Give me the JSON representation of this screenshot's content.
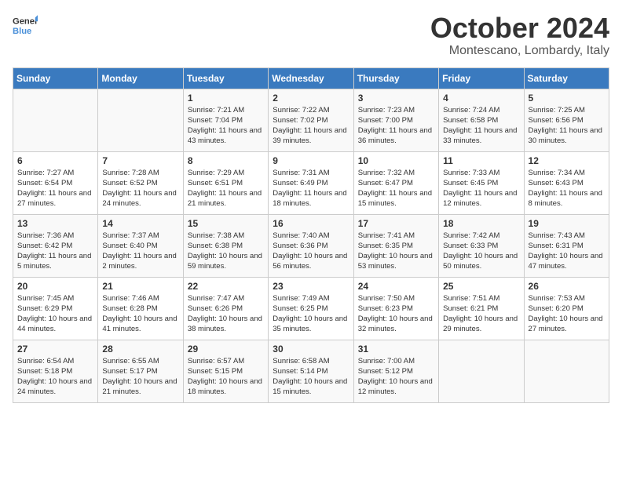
{
  "header": {
    "logo_line1": "General",
    "logo_line2": "Blue",
    "month_title": "October 2024",
    "subtitle": "Montescano, Lombardy, Italy"
  },
  "weekdays": [
    "Sunday",
    "Monday",
    "Tuesday",
    "Wednesday",
    "Thursday",
    "Friday",
    "Saturday"
  ],
  "weeks": [
    [
      {
        "day": "",
        "text": ""
      },
      {
        "day": "",
        "text": ""
      },
      {
        "day": "1",
        "text": "Sunrise: 7:21 AM\nSunset: 7:04 PM\nDaylight: 11 hours and 43 minutes."
      },
      {
        "day": "2",
        "text": "Sunrise: 7:22 AM\nSunset: 7:02 PM\nDaylight: 11 hours and 39 minutes."
      },
      {
        "day": "3",
        "text": "Sunrise: 7:23 AM\nSunset: 7:00 PM\nDaylight: 11 hours and 36 minutes."
      },
      {
        "day": "4",
        "text": "Sunrise: 7:24 AM\nSunset: 6:58 PM\nDaylight: 11 hours and 33 minutes."
      },
      {
        "day": "5",
        "text": "Sunrise: 7:25 AM\nSunset: 6:56 PM\nDaylight: 11 hours and 30 minutes."
      }
    ],
    [
      {
        "day": "6",
        "text": "Sunrise: 7:27 AM\nSunset: 6:54 PM\nDaylight: 11 hours and 27 minutes."
      },
      {
        "day": "7",
        "text": "Sunrise: 7:28 AM\nSunset: 6:52 PM\nDaylight: 11 hours and 24 minutes."
      },
      {
        "day": "8",
        "text": "Sunrise: 7:29 AM\nSunset: 6:51 PM\nDaylight: 11 hours and 21 minutes."
      },
      {
        "day": "9",
        "text": "Sunrise: 7:31 AM\nSunset: 6:49 PM\nDaylight: 11 hours and 18 minutes."
      },
      {
        "day": "10",
        "text": "Sunrise: 7:32 AM\nSunset: 6:47 PM\nDaylight: 11 hours and 15 minutes."
      },
      {
        "day": "11",
        "text": "Sunrise: 7:33 AM\nSunset: 6:45 PM\nDaylight: 11 hours and 12 minutes."
      },
      {
        "day": "12",
        "text": "Sunrise: 7:34 AM\nSunset: 6:43 PM\nDaylight: 11 hours and 8 minutes."
      }
    ],
    [
      {
        "day": "13",
        "text": "Sunrise: 7:36 AM\nSunset: 6:42 PM\nDaylight: 11 hours and 5 minutes."
      },
      {
        "day": "14",
        "text": "Sunrise: 7:37 AM\nSunset: 6:40 PM\nDaylight: 11 hours and 2 minutes."
      },
      {
        "day": "15",
        "text": "Sunrise: 7:38 AM\nSunset: 6:38 PM\nDaylight: 10 hours and 59 minutes."
      },
      {
        "day": "16",
        "text": "Sunrise: 7:40 AM\nSunset: 6:36 PM\nDaylight: 10 hours and 56 minutes."
      },
      {
        "day": "17",
        "text": "Sunrise: 7:41 AM\nSunset: 6:35 PM\nDaylight: 10 hours and 53 minutes."
      },
      {
        "day": "18",
        "text": "Sunrise: 7:42 AM\nSunset: 6:33 PM\nDaylight: 10 hours and 50 minutes."
      },
      {
        "day": "19",
        "text": "Sunrise: 7:43 AM\nSunset: 6:31 PM\nDaylight: 10 hours and 47 minutes."
      }
    ],
    [
      {
        "day": "20",
        "text": "Sunrise: 7:45 AM\nSunset: 6:29 PM\nDaylight: 10 hours and 44 minutes."
      },
      {
        "day": "21",
        "text": "Sunrise: 7:46 AM\nSunset: 6:28 PM\nDaylight: 10 hours and 41 minutes."
      },
      {
        "day": "22",
        "text": "Sunrise: 7:47 AM\nSunset: 6:26 PM\nDaylight: 10 hours and 38 minutes."
      },
      {
        "day": "23",
        "text": "Sunrise: 7:49 AM\nSunset: 6:25 PM\nDaylight: 10 hours and 35 minutes."
      },
      {
        "day": "24",
        "text": "Sunrise: 7:50 AM\nSunset: 6:23 PM\nDaylight: 10 hours and 32 minutes."
      },
      {
        "day": "25",
        "text": "Sunrise: 7:51 AM\nSunset: 6:21 PM\nDaylight: 10 hours and 29 minutes."
      },
      {
        "day": "26",
        "text": "Sunrise: 7:53 AM\nSunset: 6:20 PM\nDaylight: 10 hours and 27 minutes."
      }
    ],
    [
      {
        "day": "27",
        "text": "Sunrise: 6:54 AM\nSunset: 5:18 PM\nDaylight: 10 hours and 24 minutes."
      },
      {
        "day": "28",
        "text": "Sunrise: 6:55 AM\nSunset: 5:17 PM\nDaylight: 10 hours and 21 minutes."
      },
      {
        "day": "29",
        "text": "Sunrise: 6:57 AM\nSunset: 5:15 PM\nDaylight: 10 hours and 18 minutes."
      },
      {
        "day": "30",
        "text": "Sunrise: 6:58 AM\nSunset: 5:14 PM\nDaylight: 10 hours and 15 minutes."
      },
      {
        "day": "31",
        "text": "Sunrise: 7:00 AM\nSunset: 5:12 PM\nDaylight: 10 hours and 12 minutes."
      },
      {
        "day": "",
        "text": ""
      },
      {
        "day": "",
        "text": ""
      }
    ]
  ]
}
